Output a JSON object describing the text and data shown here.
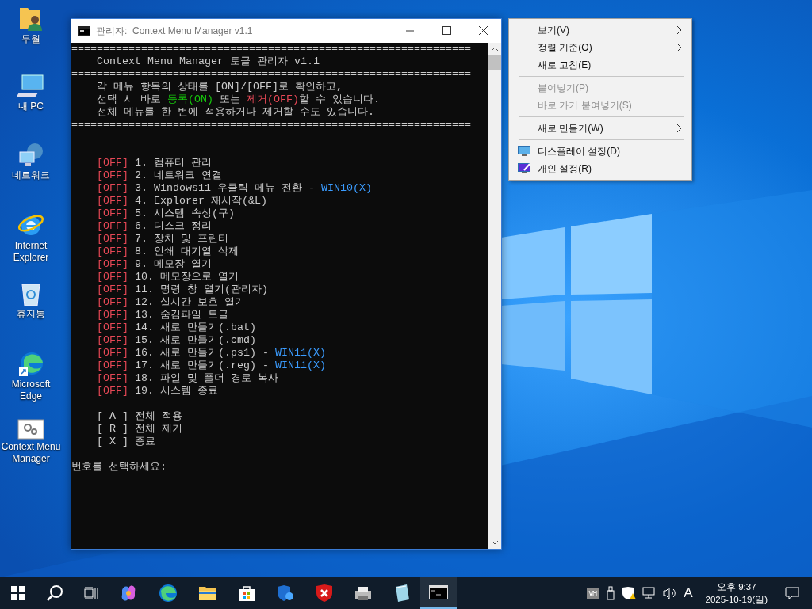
{
  "desktop_icons": [
    {
      "label": "무월"
    },
    {
      "label": "내 PC"
    },
    {
      "label": "네트워크"
    },
    {
      "label": "Internet Explorer"
    },
    {
      "label": "휴지통"
    },
    {
      "label": "Microsoft Edge"
    },
    {
      "label": "Context Menu Manager"
    }
  ],
  "console_window": {
    "title": "관리자:  Context Menu Manager v1.1",
    "header": [
      {
        "kind": "rule",
        "segments": [
          {
            "kind": "plain",
            "text": "==============================================================="
          }
        ]
      },
      {
        "kind": "indent",
        "segments": [
          {
            "kind": "plain",
            "text": "Context Menu Manager 토글 관리자 v1.1"
          }
        ]
      },
      {
        "kind": "rule",
        "segments": [
          {
            "kind": "plain",
            "text": "==============================================================="
          }
        ]
      },
      {
        "kind": "indent",
        "segments": [
          {
            "kind": "plain",
            "text": "각 메뉴 항목의 상태를 [ON]/[OFF]로 확인하고,"
          }
        ]
      },
      {
        "kind": "indent",
        "segments": [
          {
            "kind": "plain",
            "text": "선택 시 바로 "
          },
          {
            "kind": "on",
            "text": "등록(ON)"
          },
          {
            "kind": "plain",
            "text": " 또는 "
          },
          {
            "kind": "off",
            "text": "제거(OFF)"
          },
          {
            "kind": "plain",
            "text": "할 수 있습니다."
          }
        ]
      },
      {
        "kind": "indent",
        "segments": [
          {
            "kind": "plain",
            "text": "전체 메뉴를 한 번에 적용하거나 제거할 수도 있습니다."
          }
        ]
      },
      {
        "kind": "rule",
        "segments": [
          {
            "kind": "plain",
            "text": "==============================================================="
          }
        ]
      }
    ],
    "items": [
      {
        "status": "[OFF]",
        "on": false,
        "label": "1. 컴퓨터 관리"
      },
      {
        "status": "[OFF]",
        "on": false,
        "label": "2. 네트워크 연결"
      },
      {
        "status": "[OFF]",
        "on": false,
        "label": "3. Windows11 우클릭 메뉴 전환 -",
        "note": "WIN10(X)"
      },
      {
        "status": "[OFF]",
        "on": false,
        "label": "4. Explorer 재시작(&L)"
      },
      {
        "status": "[OFF]",
        "on": false,
        "label": "5. 시스템 속성(구)"
      },
      {
        "status": "[OFF]",
        "on": false,
        "label": "6. 디스크 정리"
      },
      {
        "status": "[OFF]",
        "on": false,
        "label": "7. 장치 및 프린터"
      },
      {
        "status": "[OFF]",
        "on": false,
        "label": "8. 인쇄 대기열 삭제"
      },
      {
        "status": "[OFF]",
        "on": false,
        "label": "9. 메모장 열기"
      },
      {
        "status": "[OFF]",
        "on": false,
        "label": "10. 메모장으로 열기"
      },
      {
        "status": "[OFF]",
        "on": false,
        "label": "11. 명령 창 열기(관리자)"
      },
      {
        "status": "[OFF]",
        "on": false,
        "label": "12. 실시간 보호 열기"
      },
      {
        "status": "[OFF]",
        "on": false,
        "label": "13. 숨김파일 토글"
      },
      {
        "status": "[OFF]",
        "on": false,
        "label": "14. 새로 만들기(.bat)"
      },
      {
        "status": "[OFF]",
        "on": false,
        "label": "15. 새로 만들기(.cmd)"
      },
      {
        "status": "[OFF]",
        "on": false,
        "label": "16. 새로 만들기(.ps1) -",
        "note": "WIN11(X)"
      },
      {
        "status": "[OFF]",
        "on": false,
        "label": "17. 새로 만들기(.reg) -",
        "note": "WIN11(X)"
      },
      {
        "status": "[OFF]",
        "on": false,
        "label": "18. 파일 및 폴더 경로 복사"
      },
      {
        "status": "[OFF]",
        "on": false,
        "label": "19. 시스템 종료"
      }
    ],
    "options": [
      "[ A ] 전체 적용",
      "[ R ] 전체 제거",
      "[ X ] 종료"
    ],
    "prompt": "번호를 선택하세요:"
  },
  "context_menu": [
    {
      "kind": "submenu",
      "label": "보기(V)",
      "disabled": false
    },
    {
      "kind": "submenu",
      "label": "정렬 기준(O)",
      "disabled": false
    },
    {
      "kind": "plain",
      "label": "새로 고침(E)",
      "disabled": false
    },
    {
      "kind": "separator"
    },
    {
      "kind": "plain",
      "label": "붙여넣기(P)",
      "disabled": true
    },
    {
      "kind": "plain",
      "label": "바로 가기 붙여넣기(S)",
      "disabled": true
    },
    {
      "kind": "separator"
    },
    {
      "kind": "submenu",
      "label": "새로 만들기(W)",
      "disabled": false
    },
    {
      "kind": "separator"
    },
    {
      "kind": "iconed",
      "label": "디스플레이 설정(D)",
      "disabled": false
    },
    {
      "kind": "iconed",
      "label": "개인 설정(R)",
      "disabled": false
    }
  ],
  "taskbar": {
    "ime": "A",
    "time": "오후 9:37",
    "date": "2025-10-19(일)"
  }
}
